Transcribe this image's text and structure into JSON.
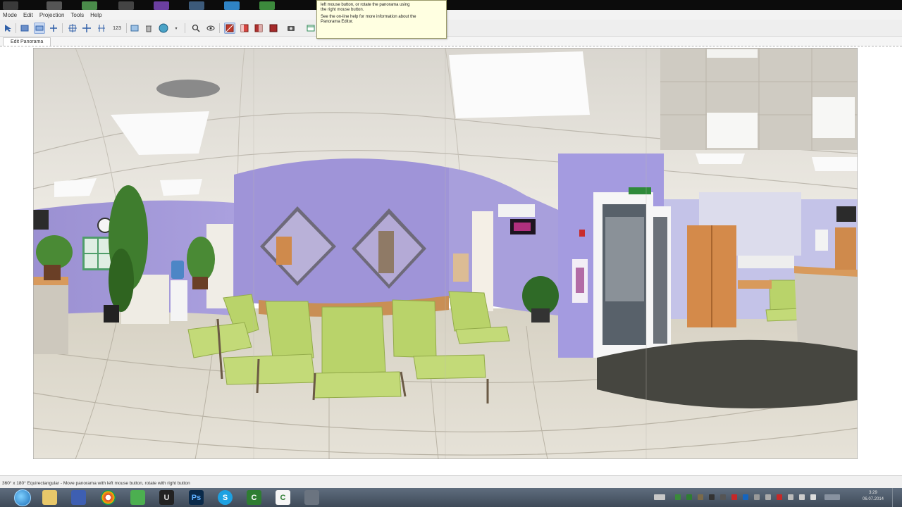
{
  "menu": [
    "Mode",
    "Edit",
    "Projection",
    "Tools",
    "Help"
  ],
  "toolbar": {
    "counter_label": "123"
  },
  "tab": {
    "label": "Edit Panorama"
  },
  "tooltip": {
    "line1": "left mouse button, or rotate the panorama using",
    "line2": "the right mouse button.",
    "line3": "See the on-line help for more information about the",
    "line4": "Panorama Editor."
  },
  "status": {
    "text": "360° x 180° Equirectangular - Move panorama with left mouse button, rotate with right button"
  },
  "taskbar": {
    "apps": [
      "ie-icon",
      "explorer-icon",
      "save-icon",
      "chrome-icon",
      "media-icon",
      "unity-icon",
      "photoshop-icon",
      "skype-icon",
      "camtasia-icon",
      "camtasia-recorder-icon",
      "app-icon"
    ],
    "clock_time": "3:29",
    "clock_date": "06.07.2014"
  },
  "colors": {
    "wall": "#9e93d6",
    "chair": "#b9d36a",
    "floor": "#dedad0",
    "door": "#cf8a4c"
  }
}
